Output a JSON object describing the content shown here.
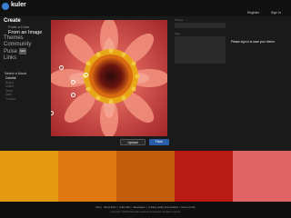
{
  "header": {
    "app_name": "kuler",
    "register": "Register",
    "sign_in": "Sign In"
  },
  "nav": {
    "create": "Create",
    "from_color": "From a Color",
    "from_image": "From an Image",
    "themes": "Themes",
    "community": "Community",
    "pulse": "Pulse",
    "pulse_badge": "NEW",
    "links": "Links"
  },
  "mood": {
    "title": "Select a Mood",
    "options": [
      "Colorful",
      "Bright",
      "Muted",
      "Deep",
      "Dark",
      "Custom"
    ]
  },
  "form": {
    "name_label": "Theme",
    "tags_label": "Tags",
    "signin_message": "Please sign in to save your theme."
  },
  "buttons": {
    "upload": "Upload",
    "flickr": "Flickr"
  },
  "swatches": [
    "#e39a12",
    "#df7810",
    "#c45d0a",
    "#b81a14",
    "#e06464"
  ],
  "footer": {
    "links": [
      "help",
      "about kuler",
      "kuler talk",
      "developers",
      "privacy policy and cookies",
      "terms of use"
    ],
    "copyright": "Copyright © 2006-2011 Adobe Systems Incorporated. All rights reserved."
  }
}
